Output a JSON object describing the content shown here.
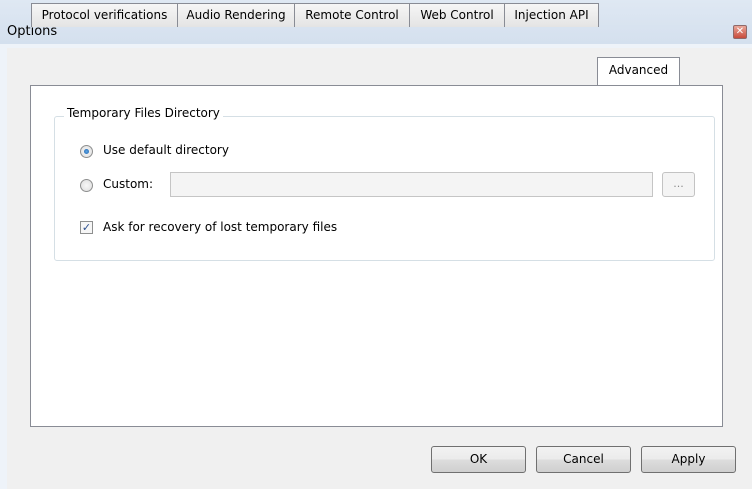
{
  "window": {
    "title": "Options"
  },
  "tabs": [
    {
      "label": "Protocol verifications",
      "active": false
    },
    {
      "label": "Audio Rendering",
      "active": false
    },
    {
      "label": "Remote Control",
      "active": false
    },
    {
      "label": "Web Control",
      "active": false
    },
    {
      "label": "Injection API",
      "active": false
    },
    {
      "label": "Advanced",
      "active": true
    }
  ],
  "temp_dir": {
    "group_title": "Temporary Files Directory",
    "default_option": {
      "label": "Use default directory",
      "selected": true
    },
    "custom_option": {
      "label": "Custom:",
      "selected": false
    },
    "custom_path_value": "",
    "browse_label": "...",
    "recovery_checkbox": {
      "label": "Ask for recovery of lost temporary files",
      "checked": true
    }
  },
  "buttons": {
    "ok": "OK",
    "cancel": "Cancel",
    "apply": "Apply"
  }
}
